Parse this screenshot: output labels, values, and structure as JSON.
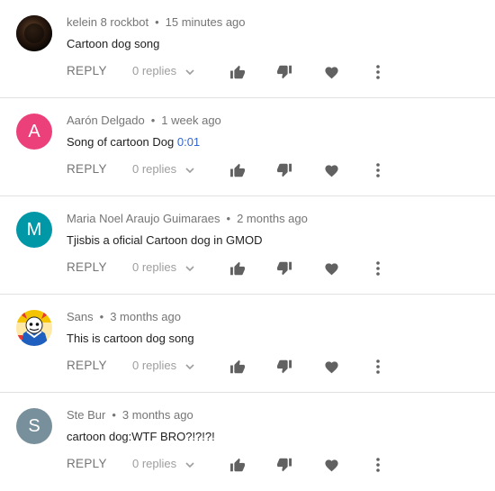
{
  "comments": [
    {
      "author": "kelein 8 rockbot",
      "time": "15 minutes ago",
      "text": "Cartoon dog song",
      "timestamp_link": "",
      "avatar": {
        "type": "image",
        "icon": "dark-orb-avatar",
        "color": "#2b1a10"
      },
      "reply_label": "REPLY",
      "replies_label": "0 replies"
    },
    {
      "author": "Aarón Delgado",
      "time": "1 week ago",
      "text": "Song of cartoon Dog ",
      "timestamp_link": "0:01",
      "avatar": {
        "type": "letter",
        "letter": "A",
        "color": "#ec407a"
      },
      "reply_label": "REPLY",
      "replies_label": "0 replies"
    },
    {
      "author": "Maria Noel Araujo Guimaraes",
      "time": "2 months ago",
      "text": "Tjisbis a oficial Cartoon dog in GMOD",
      "timestamp_link": "",
      "avatar": {
        "type": "letter",
        "letter": "M",
        "color": "#0097a7"
      },
      "reply_label": "REPLY",
      "replies_label": "0 replies"
    },
    {
      "author": "Sans",
      "time": "3 months ago",
      "text": "This is cartoon dog song",
      "timestamp_link": "",
      "avatar": {
        "type": "image",
        "icon": "cartoon-character-avatar",
        "color": "#f5c400"
      },
      "reply_label": "REPLY",
      "replies_label": "0 replies"
    },
    {
      "author": "Ste Bur",
      "time": "3 months ago",
      "text": "cartoon dog:WTF BRO?!?!?!",
      "timestamp_link": "",
      "avatar": {
        "type": "letter",
        "letter": "S",
        "color": "#78909c"
      },
      "reply_label": "REPLY",
      "replies_label": "0 replies"
    }
  ],
  "meta_separator": "•",
  "colors": {
    "icon": "#616161",
    "meta": "#757575",
    "link": "#3366cc",
    "divider": "#e0e0e0"
  }
}
